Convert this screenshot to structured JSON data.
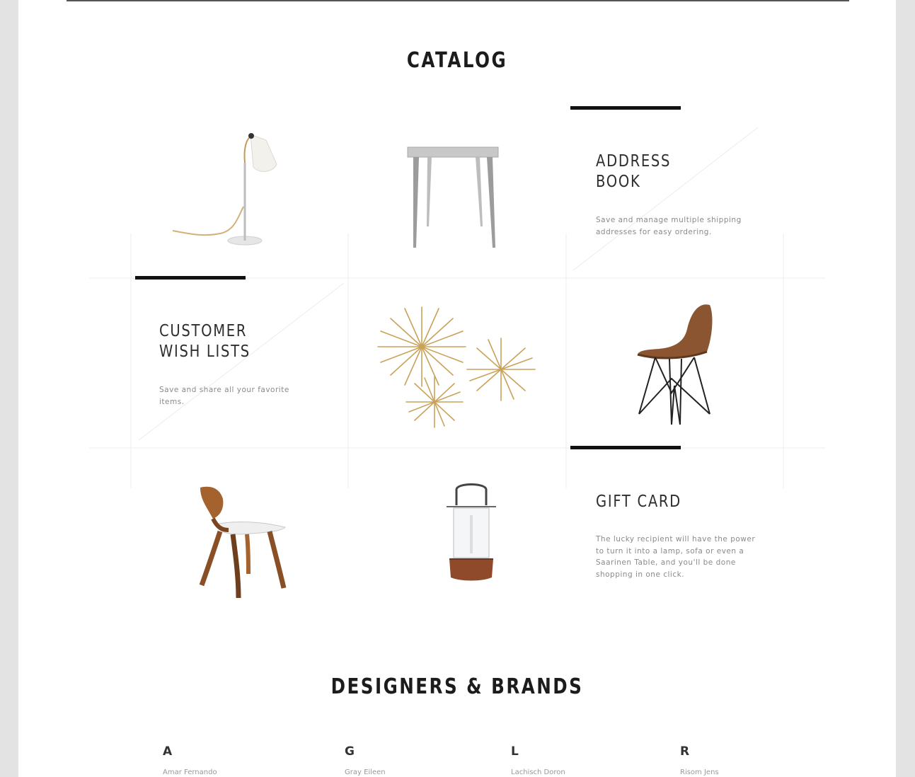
{
  "catalog": {
    "title": "CATALOG",
    "features": [
      {
        "title": "ADDRESS\nBOOK",
        "description": "Save and manage multiple shipping addresses for easy ordering."
      },
      {
        "title": "CUSTOMER\nWISH LISTS",
        "description": "Save and share all your favorite items."
      },
      {
        "title": "GIFT CARD",
        "description": "The lucky recipient will have the power to turn it into a lamp, sofa or even a Saarinen Table, and you'll be done shopping in one click."
      }
    ],
    "products": [
      {
        "name": "lamp-icon"
      },
      {
        "name": "table-icon"
      },
      {
        "name": "star-ornaments-icon"
      },
      {
        "name": "molded-chair-icon"
      },
      {
        "name": "wood-chair-icon"
      },
      {
        "name": "lantern-icon"
      }
    ]
  },
  "brands": {
    "title": "DESIGNERS & BRANDS",
    "columns": [
      {
        "letter": "A",
        "first": "Amar Fernando"
      },
      {
        "letter": "G",
        "first": "Gray Eileen"
      },
      {
        "letter": "L",
        "first": "Lachisch Doron"
      },
      {
        "letter": "R",
        "first": "Risom Jens"
      }
    ]
  },
  "colors": {
    "page_background": "#ffffff",
    "outer_background": "#e3e3e3",
    "accent_bar": "#111111",
    "wood": "#9a5b2e",
    "gold": "#c9a25a"
  }
}
